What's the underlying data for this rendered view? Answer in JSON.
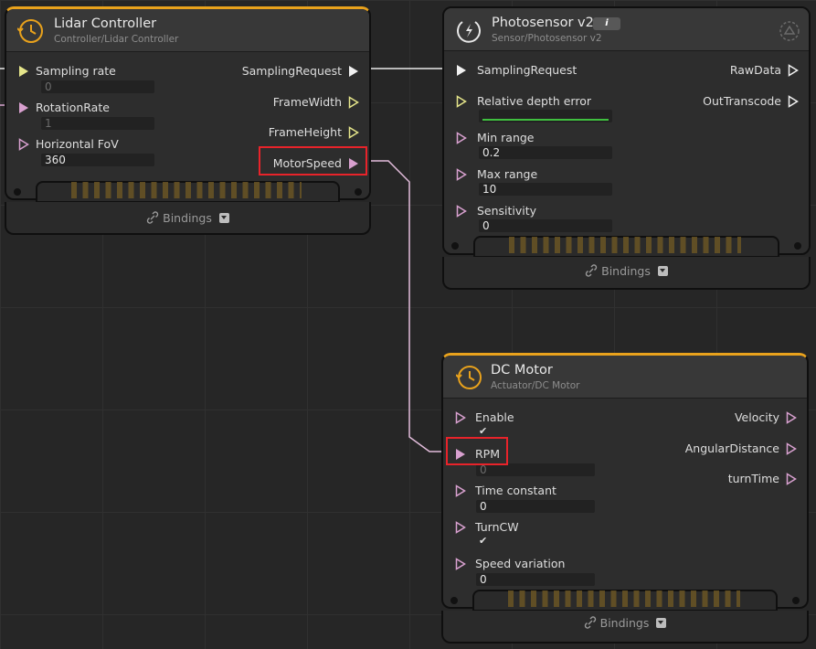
{
  "lidar": {
    "title": "Lidar Controller",
    "subtitle": "Controller/Lidar Controller",
    "inputs": [
      {
        "label": "Sampling rate",
        "value": "0"
      },
      {
        "label": "RotationRate",
        "value": "1"
      },
      {
        "label": "Horizontal FoV",
        "value": "360"
      }
    ],
    "outputs": [
      "SamplingRequest",
      "FrameWidth",
      "FrameHeight",
      "MotorSpeed"
    ],
    "bindings_label": "Bindings"
  },
  "photosensor": {
    "title": "Photosensor v2",
    "subtitle": "Sensor/Photosensor v2",
    "badge": "i",
    "inputs": [
      {
        "label": "SamplingRequest",
        "value": ""
      },
      {
        "label": "Relative depth error",
        "value": ""
      },
      {
        "label": "Min range",
        "value": "0.2"
      },
      {
        "label": "Max range",
        "value": "10"
      },
      {
        "label": "Sensitivity",
        "value": "0"
      }
    ],
    "outputs": [
      "RawData",
      "OutTranscode"
    ],
    "bindings_label": "Bindings"
  },
  "dcmotor": {
    "title": "DC Motor",
    "subtitle": "Actuator/DC Motor",
    "inputs": [
      {
        "label": "Enable",
        "value": "✔"
      },
      {
        "label": "RPM",
        "value": "0"
      },
      {
        "label": "Time constant",
        "value": "0"
      },
      {
        "label": "TurnCW",
        "value": "✔"
      },
      {
        "label": "Speed variation",
        "value": "0"
      }
    ],
    "outputs": [
      "Velocity",
      "AngularDistance",
      "turnTime"
    ],
    "bindings_label": "Bindings"
  },
  "colors": {
    "accent": "#e9a21c",
    "wire": "#d9a6d0",
    "port_yellow": "#e5e58a",
    "port_pink": "#d8a0cf",
    "port_white": "#f0f0f0",
    "highlight": "#e8232a"
  }
}
